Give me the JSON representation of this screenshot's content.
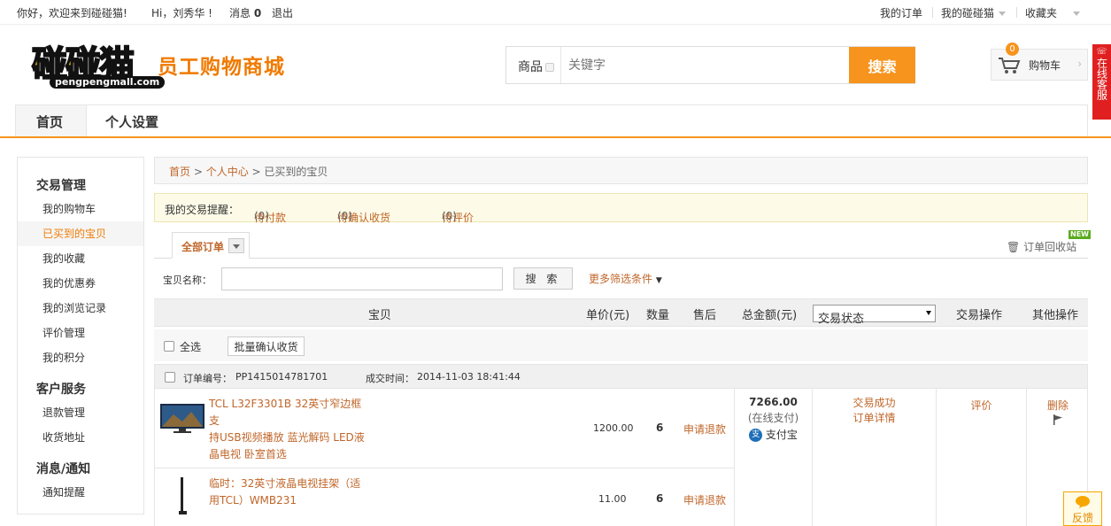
{
  "topbar": {
    "welcome": "你好，欢迎来到碰碰猫!",
    "greeting": "Hi，刘秀华 !",
    "messages_label": "消息",
    "messages_count": "0",
    "logout": "退出",
    "my_orders": "我的订单",
    "my_account": "我的碰碰猫",
    "favorites": "收藏夹"
  },
  "logo": {
    "main": "碰碰猫",
    "url": "pengpengmall.com",
    "sub": "员工购物商城"
  },
  "search": {
    "category": "商品",
    "placeholder": "关键字",
    "button": "搜索"
  },
  "cart": {
    "count": "0",
    "label": "购物车"
  },
  "service": {
    "label": "在线客服"
  },
  "nav": {
    "home": "首页",
    "settings": "个人设置"
  },
  "sidebar": {
    "groups": [
      {
        "title": "交易管理",
        "items": [
          "我的购物车",
          "已买到的宝贝",
          "我的收藏",
          "我的优惠券",
          "我的浏览记录",
          "评价管理",
          "我的积分"
        ]
      },
      {
        "title": "客户服务",
        "items": [
          "退款管理",
          "收货地址"
        ]
      },
      {
        "title": "消息/通知",
        "items": [
          "通知提醒"
        ]
      }
    ]
  },
  "breadcrumb": {
    "home": "首页",
    "center": "个人中心",
    "current": "已买到的宝贝"
  },
  "reminder": {
    "label": "我的交易提醒：",
    "pending_pay": "待付款",
    "pending_pay_count": "(0)",
    "pending_receive": "待确认收货",
    "pending_receive_count": "(0)",
    "pending_review": "待评价",
    "pending_review_count": "(0)"
  },
  "tabs": {
    "all_orders": "全部订单",
    "recycle": "订单回收站",
    "new_badge": "NEW"
  },
  "filter": {
    "name_label": "宝贝名称：",
    "search_button": "搜 索",
    "more": "更多筛选条件"
  },
  "table_header": {
    "item": "宝贝",
    "unit_price": "单价(元)",
    "quantity": "数量",
    "after_sale": "售后",
    "total": "总金额(元)",
    "status_select": "交易状态",
    "trade_ops": "交易操作",
    "other_ops": "其他操作"
  },
  "bulk": {
    "select_all": "全选",
    "confirm_button": "批量确认收货"
  },
  "order": {
    "number_label": "订单编号：",
    "number": "PP1415014781701",
    "time_label": "成交时间：",
    "time": "2014-11-03 18:41:44",
    "total": "7266.00",
    "pay_note": "(在线支付)",
    "pay_method": "支付宝",
    "status": "交易成功",
    "detail": "订单详情",
    "review": "评价",
    "delete": "删除",
    "items": [
      {
        "name_lines": [
          "TCL L32F3301B 32英寸窄边框 支",
          "持USB视频播放 蓝光解码 LED液",
          "晶电视 卧室首选"
        ],
        "price": "1200.00",
        "qty": "6",
        "refund": "申请退款"
      },
      {
        "name_lines": [
          "临时：32英寸液晶电视挂架（适",
          "用TCL）WMB231"
        ],
        "price": "11.00",
        "qty": "6",
        "refund": "申请退款"
      }
    ]
  },
  "feedback": {
    "label": "反馈"
  },
  "colors": {
    "accent": "#f7941d",
    "link": "#c0662a",
    "service_red": "#e02020"
  }
}
